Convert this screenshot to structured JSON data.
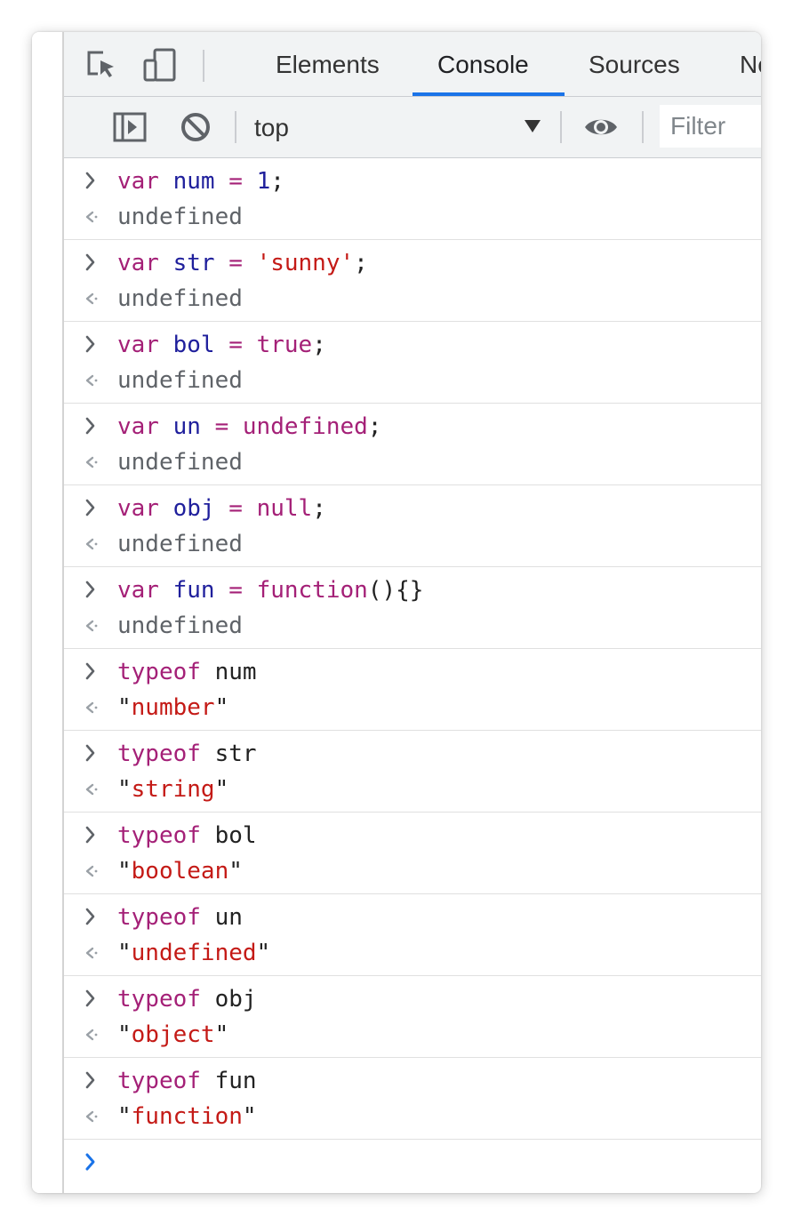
{
  "devtools": {
    "tabs": [
      {
        "label": "Elements",
        "active": false
      },
      {
        "label": "Console",
        "active": true
      },
      {
        "label": "Sources",
        "active": false
      },
      {
        "label": "Netw",
        "active": false
      }
    ],
    "toolbar": {
      "context": "top",
      "filter_placeholder": "Filter"
    },
    "icons": {
      "inspect": "inspect-element-icon",
      "device": "device-toolbar-icon",
      "sidebar": "show-sidebar-icon",
      "clear": "clear-console-icon",
      "live_expression": "eye-icon",
      "context_dropdown": "dropdown-arrow-icon"
    },
    "colors": {
      "accent": "#1a73e8",
      "keyword": "#a42077",
      "variable": "#1f1f9c",
      "string": "#c41a16",
      "undefined": "#5f6368"
    }
  },
  "console": {
    "entries": [
      {
        "tokens": [
          [
            "kw",
            "var"
          ],
          [
            "plain",
            " "
          ],
          [
            "var",
            "num"
          ],
          [
            "plain",
            " "
          ],
          [
            "op",
            "="
          ],
          [
            "plain",
            " "
          ],
          [
            "num",
            "1"
          ],
          [
            "punc",
            ";"
          ]
        ],
        "result": {
          "type": "undefined",
          "text": "undefined"
        }
      },
      {
        "tokens": [
          [
            "kw",
            "var"
          ],
          [
            "plain",
            " "
          ],
          [
            "var",
            "str"
          ],
          [
            "plain",
            " "
          ],
          [
            "op",
            "="
          ],
          [
            "plain",
            " "
          ],
          [
            "str",
            "'sunny'"
          ],
          [
            "punc",
            ";"
          ]
        ],
        "result": {
          "type": "undefined",
          "text": "undefined"
        }
      },
      {
        "tokens": [
          [
            "kw",
            "var"
          ],
          [
            "plain",
            " "
          ],
          [
            "var",
            "bol"
          ],
          [
            "plain",
            " "
          ],
          [
            "op",
            "="
          ],
          [
            "plain",
            " "
          ],
          [
            "kw",
            "true"
          ],
          [
            "punc",
            ";"
          ]
        ],
        "result": {
          "type": "undefined",
          "text": "undefined"
        }
      },
      {
        "tokens": [
          [
            "kw",
            "var"
          ],
          [
            "plain",
            " "
          ],
          [
            "var",
            "un"
          ],
          [
            "plain",
            " "
          ],
          [
            "op",
            "="
          ],
          [
            "plain",
            " "
          ],
          [
            "kw",
            "undefined"
          ],
          [
            "punc",
            ";"
          ]
        ],
        "result": {
          "type": "undefined",
          "text": "undefined"
        }
      },
      {
        "tokens": [
          [
            "kw",
            "var"
          ],
          [
            "plain",
            " "
          ],
          [
            "var",
            "obj"
          ],
          [
            "plain",
            " "
          ],
          [
            "op",
            "="
          ],
          [
            "plain",
            " "
          ],
          [
            "kw",
            "null"
          ],
          [
            "punc",
            ";"
          ]
        ],
        "result": {
          "type": "undefined",
          "text": "undefined"
        }
      },
      {
        "tokens": [
          [
            "kw",
            "var"
          ],
          [
            "plain",
            " "
          ],
          [
            "var",
            "fun"
          ],
          [
            "plain",
            " "
          ],
          [
            "op",
            "="
          ],
          [
            "plain",
            " "
          ],
          [
            "kw",
            "function"
          ],
          [
            "punc",
            "(){}"
          ]
        ],
        "result": {
          "type": "undefined",
          "text": "undefined"
        }
      },
      {
        "tokens": [
          [
            "kw",
            "typeof"
          ],
          [
            "plain",
            " num"
          ]
        ],
        "result": {
          "type": "string",
          "text": "number"
        }
      },
      {
        "tokens": [
          [
            "kw",
            "typeof"
          ],
          [
            "plain",
            " str"
          ]
        ],
        "result": {
          "type": "string",
          "text": "string"
        }
      },
      {
        "tokens": [
          [
            "kw",
            "typeof"
          ],
          [
            "plain",
            " bol"
          ]
        ],
        "result": {
          "type": "string",
          "text": "boolean"
        }
      },
      {
        "tokens": [
          [
            "kw",
            "typeof"
          ],
          [
            "plain",
            " un"
          ]
        ],
        "result": {
          "type": "string",
          "text": "undefined"
        }
      },
      {
        "tokens": [
          [
            "kw",
            "typeof"
          ],
          [
            "plain",
            " obj"
          ]
        ],
        "result": {
          "type": "string",
          "text": "object"
        }
      },
      {
        "tokens": [
          [
            "kw",
            "typeof"
          ],
          [
            "plain",
            " fun"
          ]
        ],
        "result": {
          "type": "string",
          "text": "function"
        }
      }
    ]
  }
}
